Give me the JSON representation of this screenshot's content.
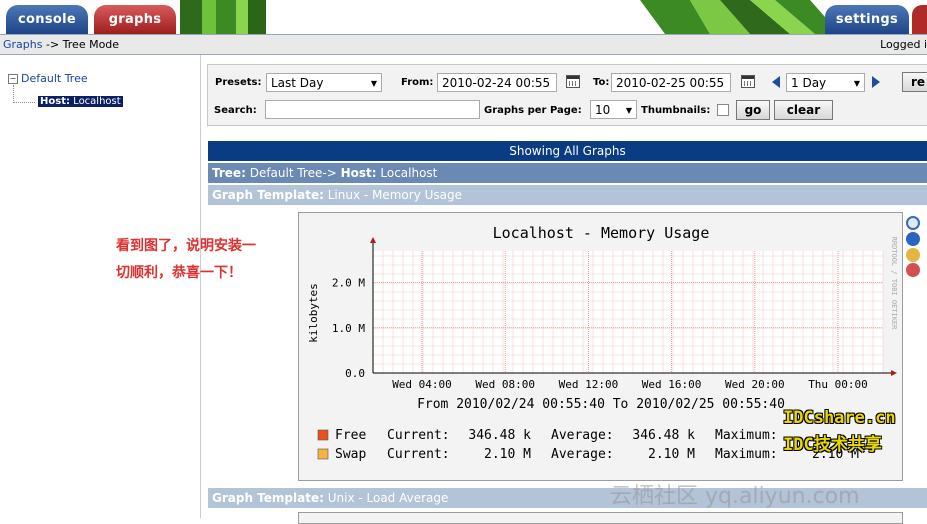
{
  "tabs": {
    "console": "console",
    "graphs": "graphs",
    "settings": "settings"
  },
  "breadcrumb": {
    "link": "Graphs",
    "separator": "->",
    "current": "Tree Mode",
    "logged": "Logged i"
  },
  "tree": {
    "root": "Default Tree",
    "host_label": "Host:",
    "host_name": "Localhost"
  },
  "filter": {
    "presets_label": "Presets:",
    "presets_value": "Last Day",
    "from_label": "From:",
    "from_value": "2010-02-24 00:55",
    "to_label": "To:",
    "to_value": "2010-02-25 00:55",
    "timespan_value": "1 Day",
    "refresh_label": "re",
    "search_label": "Search:",
    "search_value": "",
    "gpp_label": "Graphs per Page:",
    "gpp_value": "10",
    "thumbnails_label": "Thumbnails:",
    "go_label": "go",
    "clear_label": "clear"
  },
  "results": {
    "showing": "Showing All Graphs",
    "tree_prefix": "Tree:",
    "tree_value": "Default Tree->",
    "host_prefix": "Host:",
    "host_value": "Localhost",
    "template_prefix": "Graph Template:",
    "template1": "Linux - Memory Usage",
    "template2": "Unix - Load Average"
  },
  "chart_data": {
    "type": "area",
    "title": "Localhost - Memory Usage",
    "ylabel": "kilobytes",
    "y_ticks": [
      "0.0",
      "1.0 M",
      "2.0 M"
    ],
    "ylim": [
      0,
      2.7
    ],
    "x_ticks": [
      "Wed 04:00",
      "Wed 08:00",
      "Wed 12:00",
      "Wed 16:00",
      "Wed 20:00",
      "Thu 00:00"
    ],
    "time_range": "From 2010/02/24 00:55:40 To 2010/02/25 00:55:40",
    "side_text": "RRDTOOL / TOBI OETIKER",
    "series": [
      {
        "name": "Free",
        "color": "#e8501e",
        "current": "346.48 k",
        "average": "346.48 k",
        "maximum": ""
      },
      {
        "name": "Swap",
        "color": "#f5b342",
        "current": "2.10 M",
        "average": "2.10 M",
        "maximum": "2.10 M"
      }
    ],
    "labels": {
      "current": "Current:",
      "average": "Average:",
      "maximum": "Maximum:"
    }
  },
  "annotation": {
    "line1": "看到图了，说明安装一",
    "line2": "切顺利，恭喜一下！"
  },
  "watermarks": {
    "wm1": "IDCshare.cn",
    "wm2": "IDC技术共享",
    "wm3": "云栖社区 yq.aliyun.com"
  },
  "colors": {
    "accent_blue": "#0a3c84",
    "tab_red": "#b02a2a"
  }
}
